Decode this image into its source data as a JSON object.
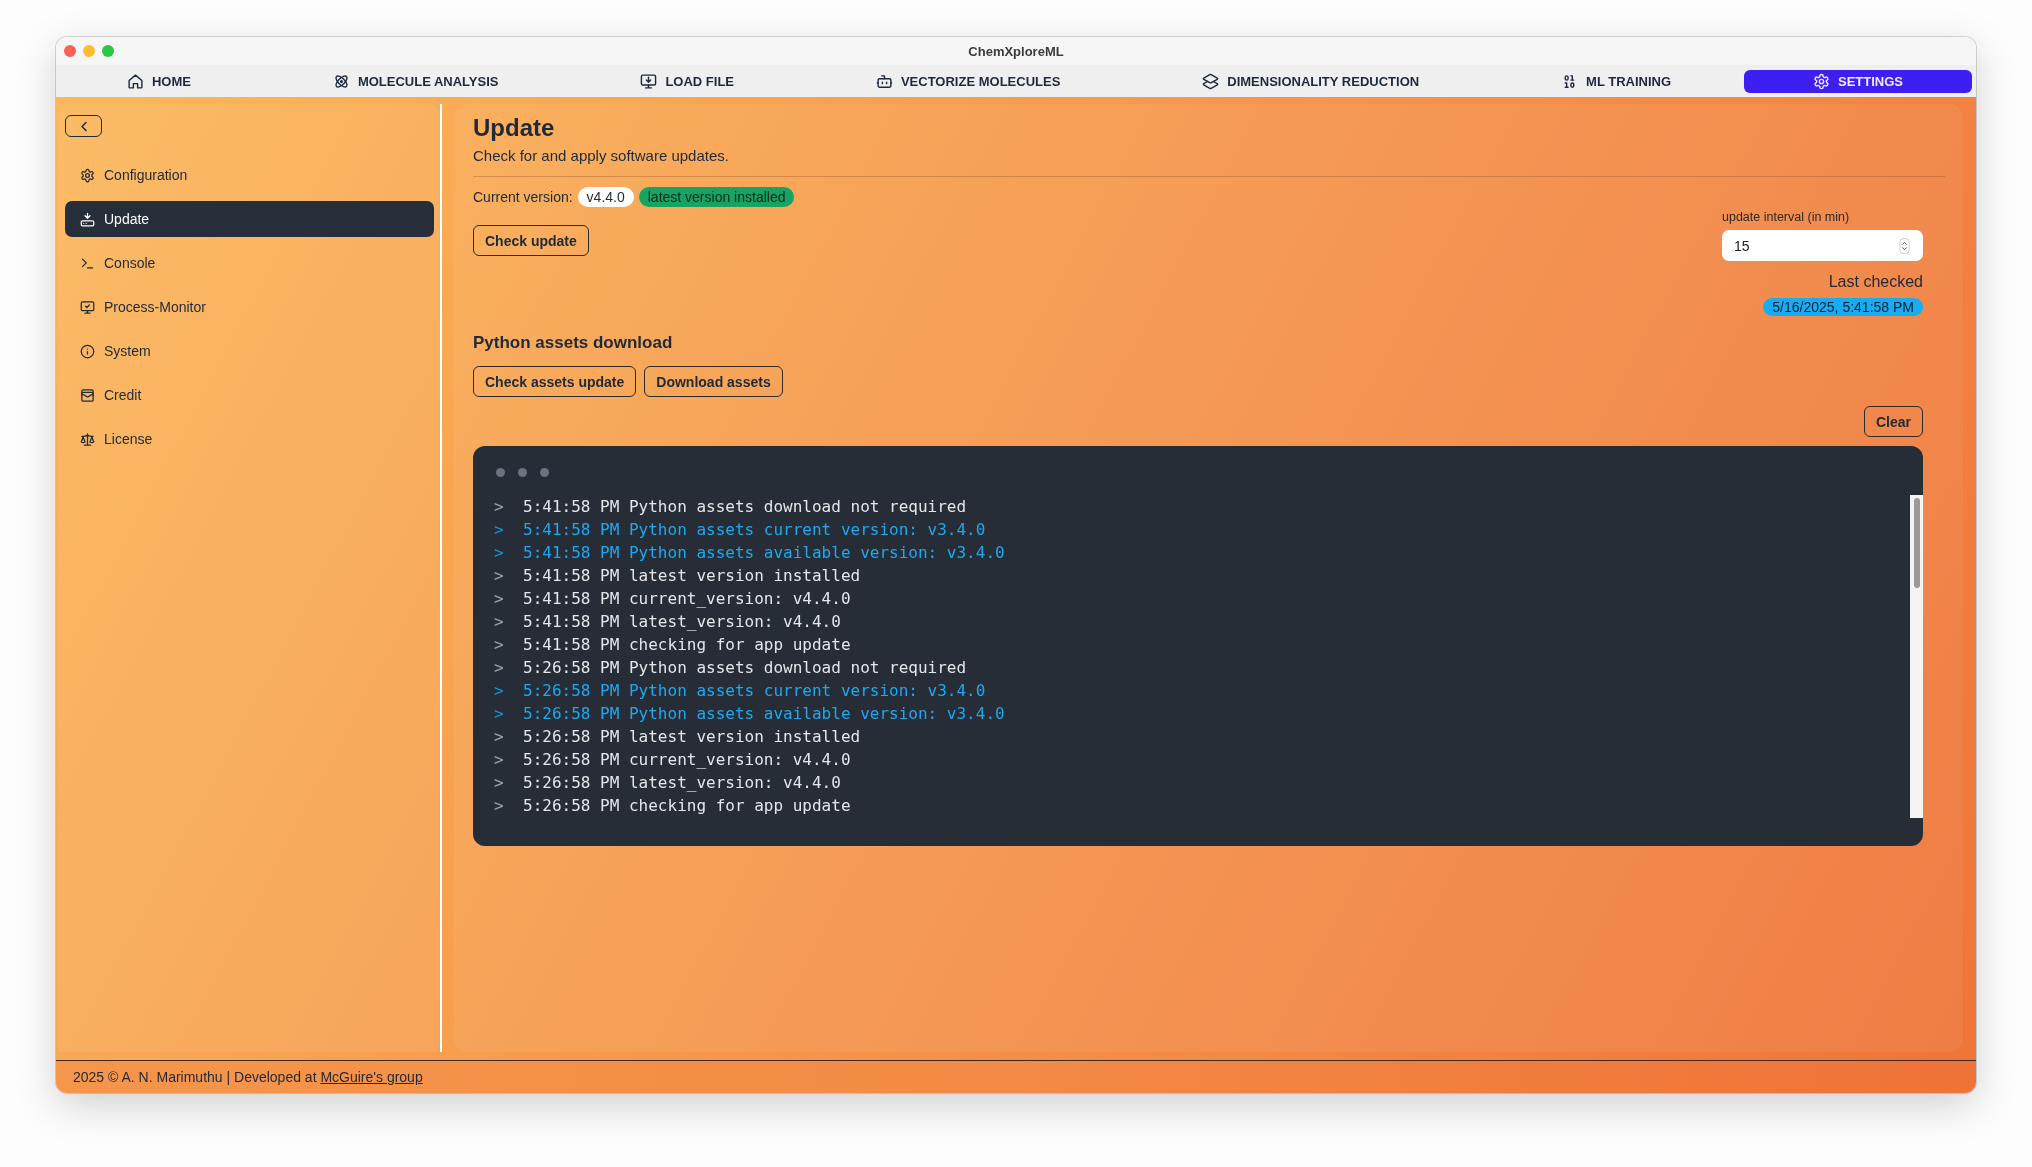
{
  "window": {
    "title": "ChemXploreML"
  },
  "tabs": [
    {
      "label": "HOME",
      "selected": false
    },
    {
      "label": "MOLECULE ANALYSIS",
      "selected": false
    },
    {
      "label": "LOAD FILE",
      "selected": false
    },
    {
      "label": "VECTORIZE MOLECULES",
      "selected": false
    },
    {
      "label": "DIMENSIONALITY REDUCTION",
      "selected": false
    },
    {
      "label": "ML TRAINING",
      "selected": false
    },
    {
      "label": "SETTINGS",
      "selected": true
    }
  ],
  "sidebar": {
    "items": [
      {
        "label": "Configuration",
        "selected": false
      },
      {
        "label": "Update",
        "selected": true
      },
      {
        "label": "Console",
        "selected": false
      },
      {
        "label": "Process-Monitor",
        "selected": false
      },
      {
        "label": "System",
        "selected": false
      },
      {
        "label": "Credit",
        "selected": false
      },
      {
        "label": "License",
        "selected": false
      }
    ]
  },
  "update": {
    "title": "Update",
    "subtitle": "Check for and apply software updates.",
    "version_label": "Current version:",
    "version": "v4.4.0",
    "status_badge": "latest version installed",
    "check_button": "Check update",
    "interval": {
      "label": "update interval (in min)",
      "value": "15"
    },
    "last_checked": {
      "label": "Last checked",
      "value": "5/16/2025, 5:41:58 PM"
    }
  },
  "assets": {
    "title": "Python assets download",
    "buttons": [
      "Check assets update",
      "Download assets"
    ]
  },
  "console": {
    "clear_button": "Clear",
    "lines": [
      {
        "kind": "normal",
        "prompt": ">",
        "text": "5:41:58 PM Python assets download not required"
      },
      {
        "kind": "highlight",
        "prompt": ">",
        "text": "5:41:58 PM Python assets current version: v3.4.0"
      },
      {
        "kind": "highlight",
        "prompt": ">",
        "text": "5:41:58 PM Python assets available version: v3.4.0"
      },
      {
        "kind": "normal",
        "prompt": ">",
        "text": "5:41:58 PM latest version installed"
      },
      {
        "kind": "normal",
        "prompt": ">",
        "text": "5:41:58 PM current_version: v4.4.0"
      },
      {
        "kind": "normal",
        "prompt": ">",
        "text": "5:41:58 PM latest_version: v4.4.0"
      },
      {
        "kind": "normal",
        "prompt": ">",
        "text": "5:41:58 PM checking for app update"
      },
      {
        "kind": "normal",
        "prompt": ">",
        "text": "5:26:58 PM Python assets download not required"
      },
      {
        "kind": "highlight",
        "prompt": ">",
        "text": "5:26:58 PM Python assets current version: v3.4.0"
      },
      {
        "kind": "highlight",
        "prompt": ">",
        "text": "5:26:58 PM Python assets available version: v3.4.0"
      },
      {
        "kind": "normal",
        "prompt": ">",
        "text": "5:26:58 PM latest version installed"
      },
      {
        "kind": "normal",
        "prompt": ">",
        "text": "5:26:58 PM current_version: v4.4.0"
      },
      {
        "kind": "normal",
        "prompt": ">",
        "text": "5:26:58 PM latest_version: v4.4.0"
      },
      {
        "kind": "normal",
        "prompt": ">",
        "text": "5:26:58 PM checking for app update"
      }
    ]
  },
  "footer": {
    "text": "2025 © A. N. Marimuthu | Developed at",
    "link": "McGuire's group"
  }
}
